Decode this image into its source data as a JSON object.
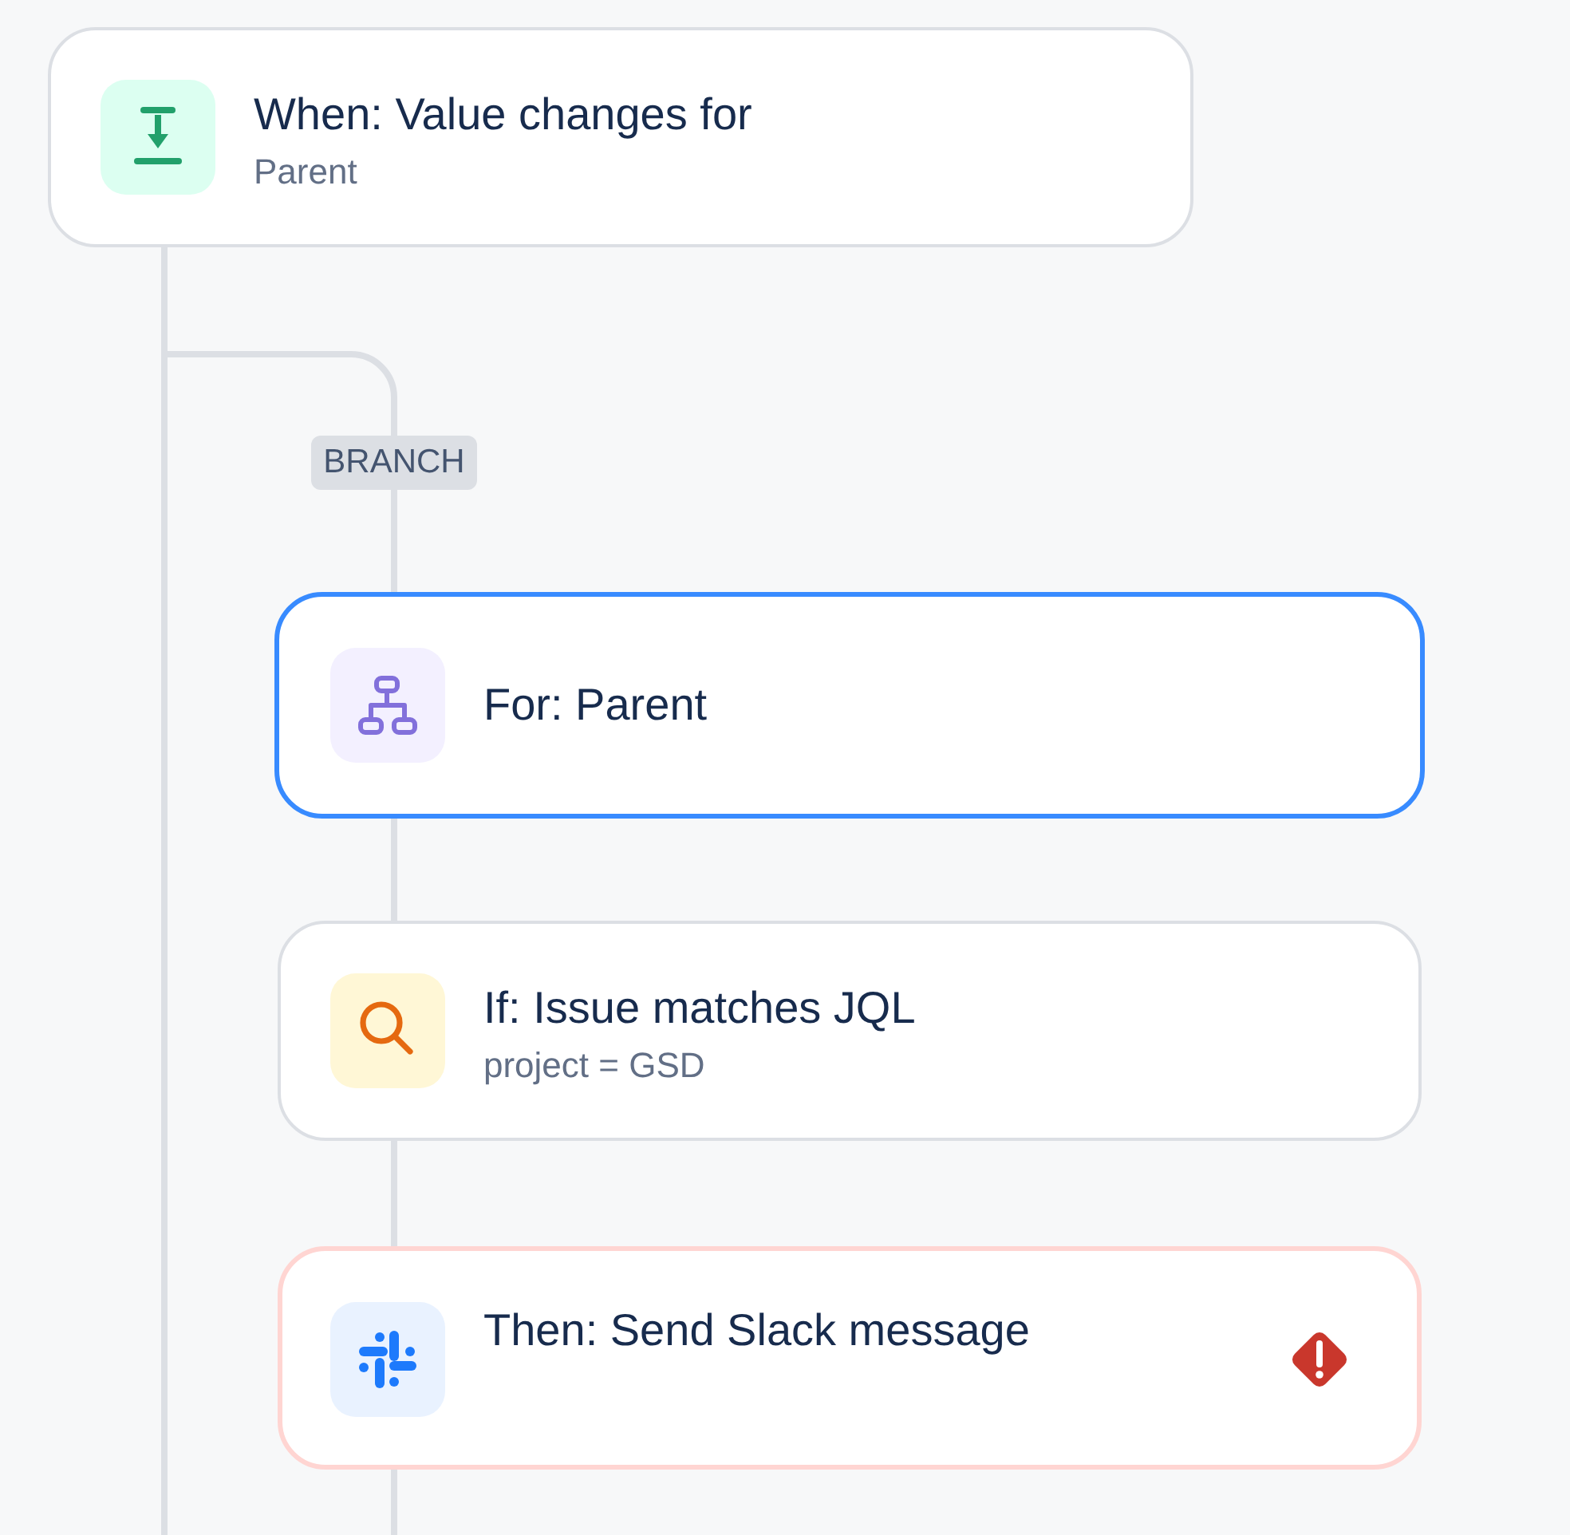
{
  "trigger": {
    "kind": "trigger",
    "title": "When: Value changes for",
    "subtitle": "Parent",
    "selected": false,
    "error": false
  },
  "branch": {
    "label": "BRANCH",
    "steps": [
      {
        "kind": "for",
        "title": "For: Parent",
        "selected": true,
        "error": false
      },
      {
        "kind": "condition",
        "title": "If: Issue matches JQL",
        "subtitle": "project = GSD",
        "selected": false,
        "error": false
      },
      {
        "kind": "action",
        "title": "Then: Send Slack message",
        "selected": false,
        "error": true
      }
    ]
  }
}
